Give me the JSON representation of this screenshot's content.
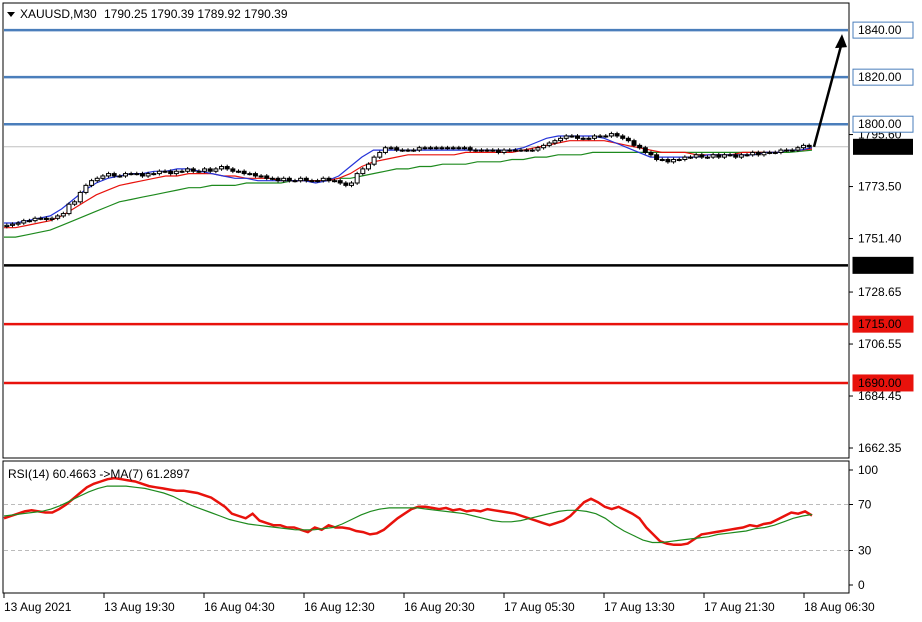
{
  "header": {
    "symbol": "XAUUSD,M30",
    "ohlc": "1790.25 1790.39 1789.92 1790.39"
  },
  "rsi_header": {
    "label": "RSI(14) 60.4663 ->MA(7) 61.2897"
  },
  "colors": {
    "level_blue": "#4a7ebb",
    "level_red": "#e8120c",
    "level_black": "#000000",
    "ma_fast": "#2433d8",
    "ma_mid": "#e8120c",
    "ma_slow": "#1e8a1e",
    "rsi_line": "#e8120c",
    "rsi_ma": "#1e8a1e"
  },
  "chart_data": [
    {
      "type": "candlestick",
      "symbol": "XAUUSD",
      "timeframe": "M30",
      "ylim": [
        1662.35,
        1846
      ],
      "y_ticks": [
        "1795.60",
        "1773.50",
        "1751.40",
        "1728.65",
        "1706.55",
        "1684.45",
        "1662.35"
      ],
      "x_ticks": [
        "13 Aug 2021",
        "13 Aug 19:30",
        "16 Aug 04:30",
        "16 Aug 12:30",
        "16 Aug 20:30",
        "17 Aug 05:30",
        "17 Aug 13:30",
        "17 Aug 21:30",
        "18 Aug 06:30"
      ],
      "current_price": "1790.39",
      "levels": [
        {
          "label": "1840.00",
          "value": 1840,
          "color": "blue"
        },
        {
          "label": "1820.00",
          "value": 1820,
          "color": "blue"
        },
        {
          "label": "1800.00",
          "value": 1800,
          "color": "blue"
        },
        {
          "label": "1740.00",
          "value": 1740,
          "color": "black"
        },
        {
          "label": "1715.00",
          "value": 1715,
          "color": "red"
        },
        {
          "label": "1690.00",
          "value": 1690,
          "color": "red"
        }
      ],
      "close": [
        1757,
        1757.5,
        1758,
        1759,
        1759,
        1760,
        1760,
        1759.5,
        1760,
        1761,
        1762,
        1766,
        1767,
        1771,
        1774,
        1776,
        1777,
        1778,
        1779,
        1778,
        1778,
        1779,
        1779,
        1779,
        1778,
        1779,
        1779,
        1780,
        1780,
        1779,
        1780,
        1780,
        1781,
        1780,
        1780,
        1781,
        1780,
        1781,
        1782,
        1781,
        1780,
        1780,
        1779,
        1779,
        1778,
        1778,
        1777,
        1777,
        1776,
        1777,
        1776,
        1776,
        1777,
        1776,
        1776,
        1776,
        1777,
        1776,
        1776,
        1775,
        1774,
        1775,
        1779,
        1781,
        1783,
        1786,
        1788,
        1790,
        1790,
        1789,
        1789,
        1789,
        1789,
        1790,
        1790,
        1790,
        1790,
        1790,
        1790,
        1790,
        1790,
        1790,
        1789,
        1789,
        1789,
        1789,
        1789,
        1788,
        1789,
        1789,
        1789,
        1789,
        1789,
        1789,
        1790,
        1791,
        1792,
        1793,
        1794,
        1795,
        1795,
        1794,
        1794,
        1794,
        1795,
        1795,
        1795,
        1796,
        1795,
        1794,
        1793,
        1791,
        1790,
        1788,
        1787,
        1785,
        1785,
        1784,
        1785,
        1785,
        1786,
        1786,
        1787,
        1786,
        1786,
        1787,
        1786,
        1787,
        1787,
        1786,
        1787,
        1787,
        1788,
        1787,
        1788,
        1788,
        1788,
        1789,
        1789,
        1789,
        1790,
        1791,
        1790.39
      ],
      "ma_fast": [
        1758,
        1758,
        1759,
        1760,
        1761,
        1764,
        1768,
        1772,
        1775,
        1777,
        1778,
        1779,
        1779,
        1780,
        1780,
        1781,
        1781,
        1780,
        1779,
        1778,
        1777,
        1777,
        1776,
        1776,
        1776,
        1776,
        1776,
        1775,
        1776,
        1778,
        1782,
        1786,
        1789,
        1789,
        1789,
        1789,
        1789,
        1789,
        1789,
        1789,
        1789,
        1789,
        1789,
        1789,
        1789,
        1790,
        1792,
        1794,
        1795,
        1795,
        1795,
        1795,
        1794,
        1792,
        1790,
        1788,
        1786,
        1786,
        1786,
        1786,
        1786,
        1787,
        1787,
        1787,
        1787,
        1787,
        1788,
        1788,
        1789,
        1789,
        1790
      ],
      "ma_mid": [
        1756,
        1756,
        1757,
        1758,
        1759,
        1761,
        1764,
        1767,
        1770,
        1772,
        1774,
        1775,
        1776,
        1777,
        1778,
        1778,
        1779,
        1779,
        1779,
        1778,
        1778,
        1777,
        1777,
        1777,
        1776,
        1776,
        1776,
        1776,
        1776,
        1777,
        1779,
        1782,
        1784,
        1785,
        1786,
        1787,
        1787,
        1787,
        1787,
        1787,
        1788,
        1788,
        1788,
        1788,
        1788,
        1789,
        1790,
        1791,
        1792,
        1793,
        1793,
        1793,
        1793,
        1792,
        1791,
        1790,
        1789,
        1788,
        1788,
        1788,
        1787,
        1787,
        1787,
        1787,
        1788,
        1788,
        1788,
        1788,
        1789,
        1789,
        1789.5
      ],
      "ma_slow": [
        1752,
        1752,
        1753,
        1754,
        1755,
        1757,
        1759,
        1761,
        1763,
        1765,
        1767,
        1768,
        1769,
        1770,
        1771,
        1772,
        1773,
        1773,
        1774,
        1774,
        1774,
        1775,
        1775,
        1775,
        1775,
        1776,
        1776,
        1776,
        1776,
        1777,
        1777,
        1778,
        1779,
        1780,
        1781,
        1781,
        1782,
        1782,
        1783,
        1783,
        1783,
        1784,
        1784,
        1784,
        1785,
        1785,
        1786,
        1786,
        1787,
        1787,
        1787,
        1788,
        1788,
        1788,
        1788,
        1788,
        1788,
        1788,
        1788,
        1788,
        1788,
        1788,
        1788,
        1788,
        1788,
        1788,
        1788,
        1788,
        1788,
        1788.5,
        1789
      ]
    },
    {
      "type": "line",
      "name_label": "RSI",
      "ylim": [
        0,
        100
      ],
      "y_ticks": [
        "100",
        "70",
        "30",
        "0"
      ],
      "reference_levels": [
        70,
        30
      ],
      "rsi": [
        58,
        60,
        62,
        64,
        65,
        64,
        63,
        63,
        66,
        70,
        75,
        80,
        85,
        88,
        90,
        92,
        93,
        92,
        91,
        90,
        88,
        86,
        85,
        84,
        83,
        82,
        82,
        81,
        80,
        78,
        76,
        72,
        68,
        62,
        60,
        58,
        62,
        56,
        54,
        52,
        52,
        50,
        50,
        48,
        46,
        50,
        48,
        52,
        50,
        50,
        49,
        47,
        46,
        44,
        45,
        48,
        53,
        58,
        62,
        66,
        68,
        68,
        67,
        66,
        67,
        65,
        66,
        64,
        65,
        64,
        66,
        65,
        64,
        63,
        62,
        60,
        58,
        56,
        54,
        52,
        54,
        56,
        60,
        66,
        72,
        75,
        72,
        68,
        66,
        68,
        65,
        62,
        58,
        50,
        44,
        38,
        36,
        35,
        35,
        36,
        40,
        44,
        45,
        46,
        47,
        48,
        49,
        50,
        52,
        51,
        53,
        54,
        57,
        60,
        63,
        62,
        64,
        60.47
      ],
      "rsi_ma": [
        60,
        61,
        62,
        63,
        64,
        66,
        69,
        73,
        77,
        81,
        84,
        86,
        86,
        86,
        85,
        84,
        82,
        80,
        77,
        73,
        69,
        66,
        63,
        60,
        57,
        55,
        53,
        52,
        51,
        50,
        49,
        48,
        48,
        48,
        49,
        50,
        53,
        57,
        61,
        64,
        66,
        67,
        67,
        67,
        67,
        66,
        65,
        64,
        63,
        62,
        60,
        58,
        56,
        55,
        55,
        56,
        58,
        60,
        62,
        64,
        65,
        65,
        64,
        62,
        58,
        52,
        47,
        43,
        39,
        37,
        37,
        38,
        39,
        40,
        41,
        42,
        44,
        45,
        46,
        47,
        49,
        50,
        52,
        55,
        58,
        60,
        61.29
      ]
    }
  ]
}
